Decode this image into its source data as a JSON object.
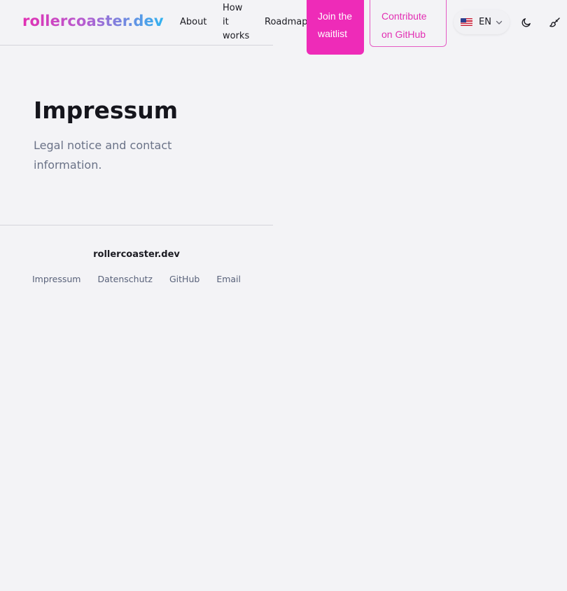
{
  "header": {
    "logo": "rollercoaster.dev",
    "nav": {
      "about": "About",
      "how_it_works": "How it works",
      "roadmap": "Roadmap"
    },
    "cta": {
      "waitlist": "Join the waitlist",
      "github": "Contribute on GitHub"
    },
    "language": {
      "flag_icon": "us-flag-icon",
      "code": "EN"
    },
    "icons": {
      "theme_toggle": "moon-icon",
      "customize": "paintbrush-icon"
    }
  },
  "main": {
    "title": "Impressum",
    "subtitle": "Legal notice and contact information."
  },
  "footer": {
    "brand": "rollercoaster.dev",
    "links": [
      "Impressum",
      "Datenschutz",
      "GitHub",
      "Email"
    ]
  },
  "colors": {
    "accent": "#ee2bb8",
    "background": "#f3f3f6",
    "muted_text": "#6a7287"
  }
}
